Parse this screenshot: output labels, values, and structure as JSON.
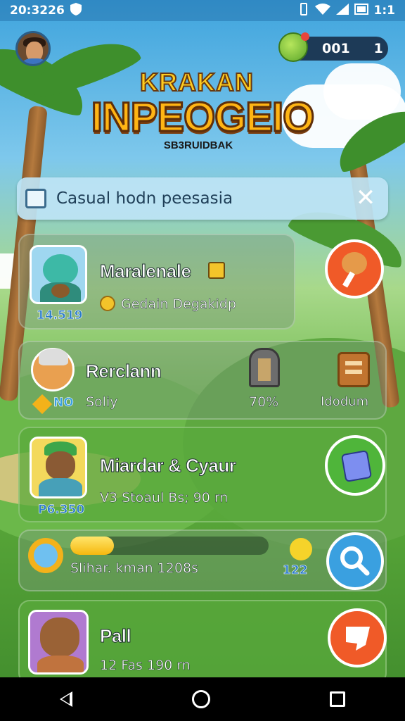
{
  "status_bar": {
    "time": "20:3226",
    "battery": "1:1"
  },
  "currency": {
    "amount": "001",
    "secondary": "1"
  },
  "logo": {
    "top": "KRAKAN",
    "main": "INPEOGEIO",
    "sub": "SB3RUIDBAK"
  },
  "notice": {
    "text": "Casual hodn peesasia",
    "close": "✕"
  },
  "cards": [
    {
      "title": "Maralenale",
      "subtitle": "Gedain Degakidp",
      "badge": "14.519"
    },
    {
      "title": "Rerclann",
      "subtitle": "Soliy",
      "badge": "NO",
      "percent": "70%",
      "side_label": "Idodum"
    },
    {
      "title": "Miardar & Cyaur",
      "subtitle": "V3 Stoaul Bs; 90 rn",
      "badge": "P6.350"
    },
    {
      "progress_label": "Slihar. kman 1208s",
      "progress_value": 0.22,
      "count": "122"
    },
    {
      "title": "Pall",
      "subtitle": "12 Fas 190 rn"
    }
  ],
  "colors": {
    "accent_orange": "#f05a28",
    "accent_blue": "#3aa0e0",
    "accent_green": "#4fb53a"
  }
}
